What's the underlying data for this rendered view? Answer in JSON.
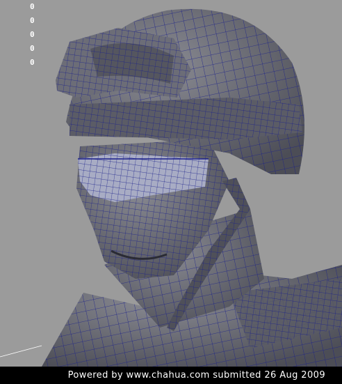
{
  "viewport": {
    "hud_values": [
      "0",
      "0",
      "0",
      "0",
      "0"
    ],
    "colors": {
      "background": "#9b9b9b",
      "mesh_fill": "#6e6f78",
      "mesh_shadow": "#4f5059",
      "wire": "#1a1f8a",
      "visor": "#a8acc4"
    }
  },
  "footer": {
    "credit_text": "Powered by www.chahua.com submitted 26 Aug 2009"
  }
}
